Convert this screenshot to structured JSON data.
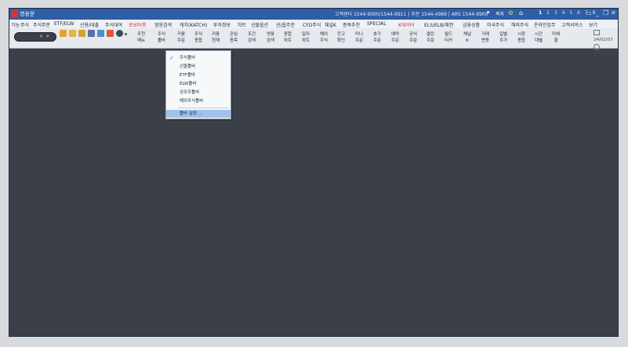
{
  "title_bar": {
    "app_title": "영웅문",
    "info": "고객센터 1544-9000/1544-9911 | 주문 1544-4989 | ARS 1544-9900",
    "tool_text": "목차",
    "screen_numbers": [
      "1",
      "2",
      "3",
      "4",
      "5",
      "6",
      "7",
      "8"
    ]
  },
  "menu": [
    {
      "label": "기능",
      "red": false
    },
    {
      "label": "주식",
      "red": false
    },
    {
      "label": "주식주문",
      "red": false
    },
    {
      "label": "ETF/ELW",
      "red": false
    },
    {
      "label": "신용/대출",
      "red": false
    },
    {
      "label": "주식대여",
      "red": false
    },
    {
      "label": "로보마켓",
      "red": true
    },
    {
      "label": "영웅검색",
      "red": false
    },
    {
      "label": "캐치(KATCH)",
      "red": false
    },
    {
      "label": "투자정보",
      "red": false
    },
    {
      "label": "차트",
      "red": false
    },
    {
      "label": "선물옵션",
      "red": false
    },
    {
      "label": "선/옵주문",
      "red": false
    },
    {
      "label": "CFD주식",
      "red": false
    },
    {
      "label": "채널K",
      "red": false
    },
    {
      "label": "종목추천",
      "red": false
    },
    {
      "label": "SPECIAL",
      "red": false
    },
    {
      "label": "K데이터",
      "red": true
    },
    {
      "label": "ELS/ELB/채권",
      "red": false
    },
    {
      "label": "금융상품",
      "red": false
    },
    {
      "label": "미국주식",
      "red": false
    },
    {
      "label": "해외주식",
      "red": false
    },
    {
      "label": "온라인업무",
      "red": false
    },
    {
      "label": "고객서비스",
      "red": false
    },
    {
      "label": "보기",
      "red": false
    }
  ],
  "toolbar": {
    "buttons": [
      {
        "l1": "주천",
        "l2": "메뉴"
      },
      {
        "l1": "주식",
        "l2": "툴바"
      },
      {
        "l1": "키움",
        "l2": "주문"
      },
      {
        "l1": "주식",
        "l2": "종합"
      },
      {
        "l1": "키움",
        "l2": "현재"
      },
      {
        "l1": "관심",
        "l2": "종목"
      },
      {
        "l1": "조건",
        "l2": "검색"
      },
      {
        "l1": "영웅",
        "l2": "검색"
      },
      {
        "l1": "종합",
        "l2": "차트"
      },
      {
        "l1": "일자",
        "l2": "차트"
      },
      {
        "l1": "해외",
        "l2": "주식"
      },
      {
        "l1": "잔고",
        "l2": "확인"
      },
      {
        "l1": "미니",
        "l2": "주문"
      },
      {
        "l1": "호가",
        "l2": "주문"
      },
      {
        "l1": "예약",
        "l2": "주문"
      },
      {
        "l1": "공식",
        "l2": "주문"
      },
      {
        "l1": "클린",
        "l2": "주문"
      },
      {
        "l1": "월드",
        "l2": "티커"
      },
      {
        "l1": "채널",
        "l2": "K"
      },
      {
        "l1": "거래",
        "l2": "변동"
      },
      {
        "l1": "일별",
        "l2": "주가"
      },
      {
        "l1": "시장",
        "l2": "종합"
      },
      {
        "l1": "시간",
        "l2": "대별"
      },
      {
        "l1": "미체",
        "l2": "결"
      }
    ],
    "date": "24/02/07",
    "time": "17:02:14"
  },
  "dropdown": {
    "items": [
      {
        "label": "주식툴바",
        "checked": true
      },
      {
        "label": "선물툴바",
        "checked": false
      },
      {
        "label": "ETF툴바",
        "checked": false
      },
      {
        "label": "ELW툴바",
        "checked": false
      },
      {
        "label": "공모주툴바",
        "checked": false
      },
      {
        "label": "해외주식툴바",
        "checked": false
      }
    ],
    "settings_label": "툴바 설정 ..."
  },
  "colors": {
    "title_bar": "#2f5da6",
    "workspace": "#3b3f48",
    "menu_red": "#d6263b",
    "highlight": "#9ec3ec"
  }
}
